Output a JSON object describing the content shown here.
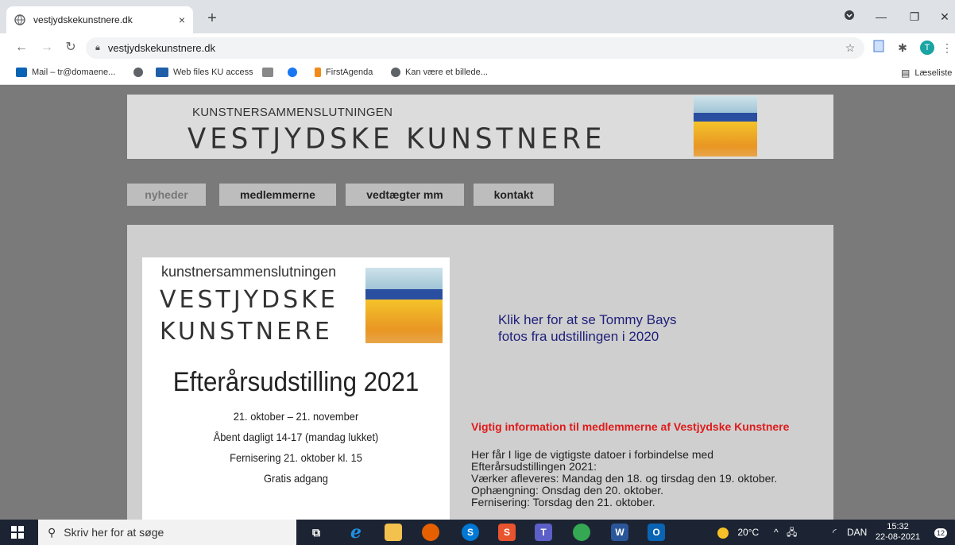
{
  "browser": {
    "tab_title": "vestjydskekunstnere.dk",
    "tab_close": "×",
    "new_tab": "+",
    "url": "vestjydskekunstnere.dk",
    "bookmarks": [
      {
        "label": "Mail – tr@domaene...",
        "icon": "outlook-icon",
        "color": "#0a64b4"
      },
      {
        "label": "",
        "icon": "globe-icon",
        "color": "#5f6368"
      },
      {
        "label": "Web files KU access",
        "icon": "web-files-icon",
        "color": "#1f5fa8"
      },
      {
        "label": "",
        "icon": "building-icon",
        "color": "#888888"
      },
      {
        "label": "",
        "icon": "facebook-icon",
        "color": "#1877f2"
      },
      {
        "label": "FirstAgenda",
        "icon": "firstagenda-icon",
        "color": "#f08a1c"
      },
      {
        "label": "Kan være et billede...",
        "icon": "globe-icon",
        "color": "#5f6368"
      }
    ],
    "reading_list": "Læseliste",
    "profile_initial": "T"
  },
  "site": {
    "banner_small": "KUNSTNERSAMMENSLUTNINGEN",
    "banner_big": "VESTJYDSKE KUNSTNERE",
    "nav": [
      {
        "label": "nyheder",
        "active": true
      },
      {
        "label": "medlemmerne",
        "active": false
      },
      {
        "label": "vedtægter mm",
        "active": false
      },
      {
        "label": "kontakt",
        "active": false
      }
    ],
    "poster": {
      "small": "kunstnersammenslutningen",
      "big1": "VESTJYDSKE",
      "big2": "KUNSTNERE",
      "title": "Efterårsudstilling 2021",
      "lines": [
        "21. oktober – 21. november",
        "Åbent dagligt 14-17 (mandag lukket)",
        "Fernisering 21. oktober kl. 15",
        "Gratis adgang"
      ]
    },
    "foto_link_1": "Klik her for at se Tommy Bays",
    "foto_link_2": "fotos fra udstillingen i 2020",
    "important_heading": "Vigtig information til medlemmerne af Vestjydske Kunstnere",
    "info_lines": [
      "Her får I lige de vigtigste datoer i forbindelse med",
      "Efterårsudstillingen 2021:",
      "Værker afleveres: Mandag den 18. og tirsdag den 19. oktober.",
      "Ophængning: Onsdag den 20. oktober.",
      "Fernisering: Torsdag den 21. oktober."
    ]
  },
  "taskbar": {
    "search_placeholder": "Skriv her for at søge",
    "weather": "20°C",
    "language": "DAN",
    "time": "15:32",
    "date": "22-08-2021",
    "notification_count": "12"
  }
}
